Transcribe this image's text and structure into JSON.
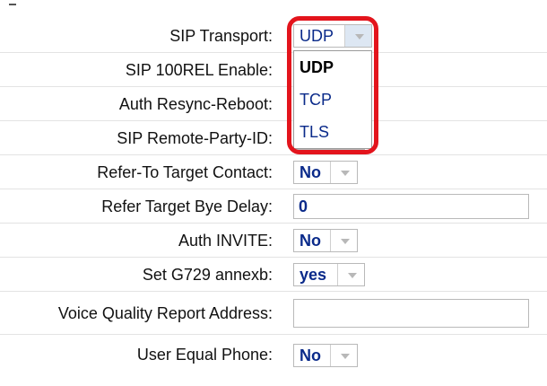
{
  "fields": [
    {
      "label": "SIP Transport:",
      "value": "UDP"
    },
    {
      "label": "SIP 100REL Enable:",
      "value": ""
    },
    {
      "label": "Auth Resync-Reboot:",
      "value": ""
    },
    {
      "label": "SIP Remote-Party-ID:",
      "value": ""
    },
    {
      "label": "Refer-To Target Contact:",
      "value": "No"
    },
    {
      "label": "Refer Target Bye Delay:",
      "value": "0"
    },
    {
      "label": "Auth INVITE:",
      "value": "No"
    },
    {
      "label": "Set G729 annexb:",
      "value": "yes"
    },
    {
      "label": "Voice Quality Report Address:",
      "value": ""
    },
    {
      "label": "User Equal Phone:",
      "value": "No"
    }
  ],
  "transport_dropdown": {
    "options": [
      "UDP",
      "TCP",
      "TLS"
    ],
    "selected": "UDP"
  },
  "colors": {
    "highlight": "#e3141c",
    "value_text": "#0a2a8a"
  }
}
